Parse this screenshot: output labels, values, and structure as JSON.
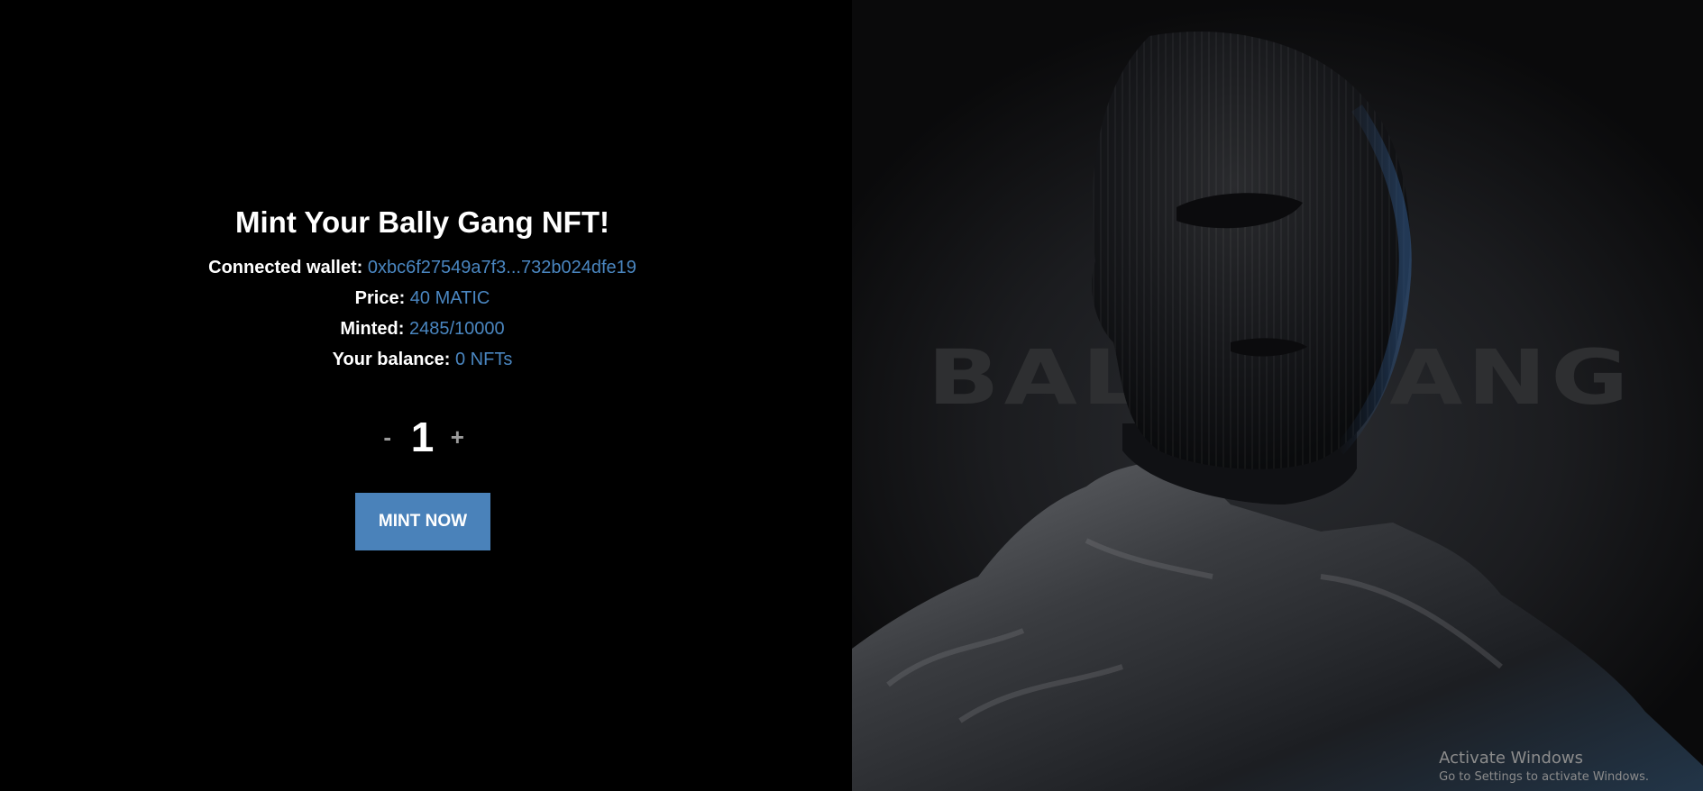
{
  "mint": {
    "title": "Mint Your Bally Gang NFT!",
    "wallet_label": "Connected wallet:",
    "wallet_value": "0xbc6f27549a7f3...732b024dfe19",
    "price_label": "Price:",
    "price_value": "40 MATIC",
    "minted_label": "Minted:",
    "minted_value": "2485/10000",
    "balance_label": "Your balance:",
    "balance_value": "0 NFTs",
    "quantity": {
      "minus": "-",
      "value": "1",
      "plus": "+"
    },
    "button_label": "MINT NOW"
  },
  "hero": {
    "brand_text": "BALLY GANG"
  },
  "os_watermark": {
    "line1": "Activate Windows",
    "line2": "Go to Settings to activate Windows."
  },
  "colors": {
    "accent": "#4a86c0",
    "button": "#4a82ba",
    "background": "#000000"
  }
}
